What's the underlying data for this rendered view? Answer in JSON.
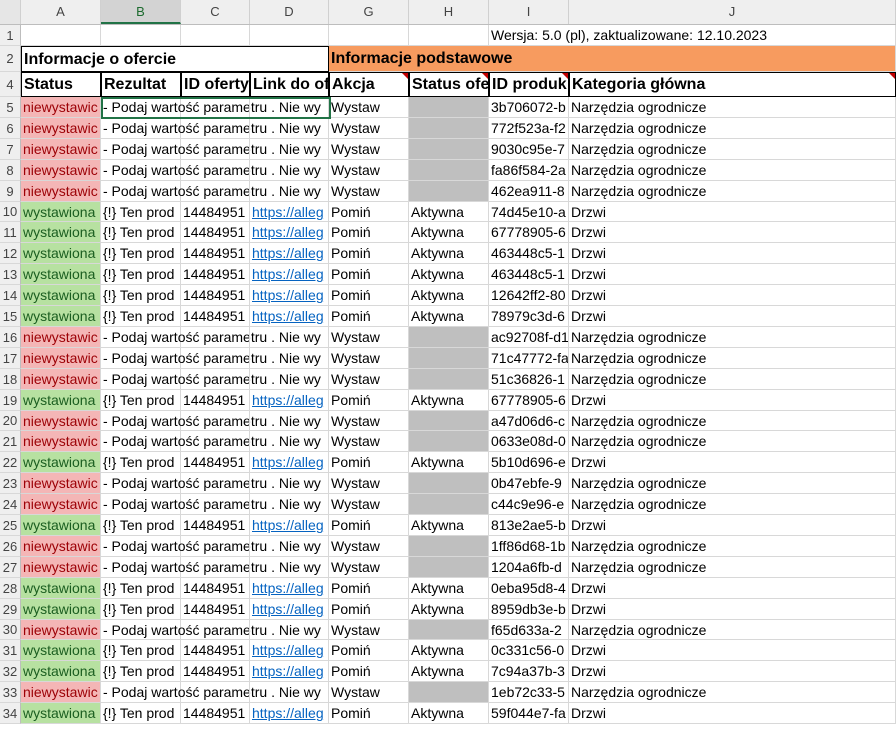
{
  "columns": [
    "A",
    "B",
    "C",
    "D",
    "G",
    "H",
    "I",
    "J"
  ],
  "row1": {
    "row": "1",
    "version": "Wersja: 5.0 (pl), zaktualizowane: 12.10.2023"
  },
  "row2": {
    "row": "2",
    "offer_info": "Informacje o ofercie",
    "basic_info": "Informacje podstawowe"
  },
  "row4": {
    "row": "4",
    "headers": [
      "Status",
      "Rezultat",
      "ID oferty",
      "Link do of",
      "Akcja",
      "Status ofe",
      "ID produk",
      "Kategoria główna"
    ]
  },
  "rows": [
    {
      "row": "5",
      "status": "niewystawic",
      "result": "- Podaj wartość parametru . Nie wy",
      "offer_id": "",
      "link": "",
      "action": "Wystaw",
      "offer_status": "",
      "product_id": "3b706072-b",
      "category": "Narzędzia ogrodnicze"
    },
    {
      "row": "6",
      "status": "niewystawic",
      "result": "- Podaj wartość parametru . Nie wy",
      "offer_id": "",
      "link": "",
      "action": "Wystaw",
      "offer_status": "",
      "product_id": "772f523a-f2",
      "category": "Narzędzia ogrodnicze"
    },
    {
      "row": "7",
      "status": "niewystawic",
      "result": "- Podaj wartość parametru . Nie wy",
      "offer_id": "",
      "link": "",
      "action": "Wystaw",
      "offer_status": "",
      "product_id": "9030c95e-7",
      "category": "Narzędzia ogrodnicze"
    },
    {
      "row": "8",
      "status": "niewystawic",
      "result": "- Podaj wartość parametru . Nie wy",
      "offer_id": "",
      "link": "",
      "action": "Wystaw",
      "offer_status": "",
      "product_id": "fa86f584-2a",
      "category": "Narzędzia ogrodnicze"
    },
    {
      "row": "9",
      "status": "niewystawic",
      "result": "- Podaj wartość parametru . Nie wy",
      "offer_id": "",
      "link": "",
      "action": "Wystaw",
      "offer_status": "",
      "product_id": "462ea911-8",
      "category": "Narzędzia ogrodnicze"
    },
    {
      "row": "10",
      "status": "wystawiona",
      "result": "{!} Ten prod",
      "offer_id": "14484951",
      "link": "https://alleg",
      "action": "Pomiń",
      "offer_status": "Aktywna",
      "product_id": "74d45e10-a",
      "category": "Drzwi"
    },
    {
      "row": "11",
      "status": "wystawiona",
      "result": "{!} Ten prod",
      "offer_id": "14484951",
      "link": "https://alleg",
      "action": "Pomiń",
      "offer_status": "Aktywna",
      "product_id": "67778905-6",
      "category": "Drzwi"
    },
    {
      "row": "12",
      "status": "wystawiona",
      "result": "{!} Ten prod",
      "offer_id": "14484951",
      "link": "https://alleg",
      "action": "Pomiń",
      "offer_status": "Aktywna",
      "product_id": "463448c5-1",
      "category": "Drzwi"
    },
    {
      "row": "13",
      "status": "wystawiona",
      "result": "{!} Ten prod",
      "offer_id": "14484951",
      "link": "https://alleg",
      "action": "Pomiń",
      "offer_status": "Aktywna",
      "product_id": "463448c5-1",
      "category": "Drzwi"
    },
    {
      "row": "14",
      "status": "wystawiona",
      "result": "{!} Ten prod",
      "offer_id": "14484951",
      "link": "https://alleg",
      "action": "Pomiń",
      "offer_status": "Aktywna",
      "product_id": "12642ff2-80",
      "category": "Drzwi"
    },
    {
      "row": "15",
      "status": "wystawiona",
      "result": "{!} Ten prod",
      "offer_id": "14484951",
      "link": "https://alleg",
      "action": "Pomiń",
      "offer_status": "Aktywna",
      "product_id": "78979c3d-6",
      "category": "Drzwi"
    },
    {
      "row": "16",
      "status": "niewystawic",
      "result": "- Podaj wartość parametru . Nie wy",
      "offer_id": "",
      "link": "",
      "action": "Wystaw",
      "offer_status": "",
      "product_id": "ac92708f-d1",
      "category": "Narzędzia ogrodnicze"
    },
    {
      "row": "17",
      "status": "niewystawic",
      "result": "- Podaj wartość parametru . Nie wy",
      "offer_id": "",
      "link": "",
      "action": "Wystaw",
      "offer_status": "",
      "product_id": "71c47772-fa",
      "category": "Narzędzia ogrodnicze"
    },
    {
      "row": "18",
      "status": "niewystawic",
      "result": "- Podaj wartość parametru . Nie wy",
      "offer_id": "",
      "link": "",
      "action": "Wystaw",
      "offer_status": "",
      "product_id": "51c36826-1",
      "category": "Narzędzia ogrodnicze"
    },
    {
      "row": "19",
      "status": "wystawiona",
      "result": "{!} Ten prod",
      "offer_id": "14484951",
      "link": "https://alleg",
      "action": "Pomiń",
      "offer_status": "Aktywna",
      "product_id": "67778905-6",
      "category": "Drzwi"
    },
    {
      "row": "20",
      "status": "niewystawic",
      "result": "- Podaj wartość parametru . Nie wy",
      "offer_id": "",
      "link": "",
      "action": "Wystaw",
      "offer_status": "",
      "product_id": "a47d06d6-c",
      "category": "Narzędzia ogrodnicze"
    },
    {
      "row": "21",
      "status": "niewystawic",
      "result": "- Podaj wartość parametru . Nie wy",
      "offer_id": "",
      "link": "",
      "action": "Wystaw",
      "offer_status": "",
      "product_id": "0633e08d-0",
      "category": "Narzędzia ogrodnicze"
    },
    {
      "row": "22",
      "status": "wystawiona",
      "result": "{!} Ten prod",
      "offer_id": "14484951",
      "link": "https://alleg",
      "action": "Pomiń",
      "offer_status": "Aktywna",
      "product_id": "5b10d696-e",
      "category": "Drzwi"
    },
    {
      "row": "23",
      "status": "niewystawic",
      "result": "- Podaj wartość parametru . Nie wy",
      "offer_id": "",
      "link": "",
      "action": "Wystaw",
      "offer_status": "",
      "product_id": "0b47ebfe-9",
      "category": "Narzędzia ogrodnicze"
    },
    {
      "row": "24",
      "status": "niewystawic",
      "result": "- Podaj wartość parametru . Nie wy",
      "offer_id": "",
      "link": "",
      "action": "Wystaw",
      "offer_status": "",
      "product_id": "c44c9e96-e",
      "category": "Narzędzia ogrodnicze"
    },
    {
      "row": "25",
      "status": "wystawiona",
      "result": "{!} Ten prod",
      "offer_id": "14484951",
      "link": "https://alleg",
      "action": "Pomiń",
      "offer_status": "Aktywna",
      "product_id": "813e2ae5-b",
      "category": "Drzwi"
    },
    {
      "row": "26",
      "status": "niewystawic",
      "result": "- Podaj wartość parametru . Nie wy",
      "offer_id": "",
      "link": "",
      "action": "Wystaw",
      "offer_status": "",
      "product_id": "1ff86d68-1b",
      "category": "Narzędzia ogrodnicze"
    },
    {
      "row": "27",
      "status": "niewystawic",
      "result": "- Podaj wartość parametru . Nie wy",
      "offer_id": "",
      "link": "",
      "action": "Wystaw",
      "offer_status": "",
      "product_id": "1204a6fb-d",
      "category": "Narzędzia ogrodnicze"
    },
    {
      "row": "28",
      "status": "wystawiona",
      "result": "{!} Ten prod",
      "offer_id": "14484951",
      "link": "https://alleg",
      "action": "Pomiń",
      "offer_status": "Aktywna",
      "product_id": "0eba95d8-4",
      "category": "Drzwi"
    },
    {
      "row": "29",
      "status": "wystawiona",
      "result": "{!} Ten prod",
      "offer_id": "14484951",
      "link": "https://alleg",
      "action": "Pomiń",
      "offer_status": "Aktywna",
      "product_id": "8959db3e-b",
      "category": "Drzwi"
    },
    {
      "row": "30",
      "status": "niewystawic",
      "result": "- Podaj wartość parametru . Nie wy",
      "offer_id": "",
      "link": "",
      "action": "Wystaw",
      "offer_status": "",
      "product_id": "f65d633a-2",
      "category": "Narzędzia ogrodnicze"
    },
    {
      "row": "31",
      "status": "wystawiona",
      "result": "{!} Ten prod",
      "offer_id": "14484951",
      "link": "https://alleg",
      "action": "Pomiń",
      "offer_status": "Aktywna",
      "product_id": "0c331c56-0",
      "category": "Drzwi"
    },
    {
      "row": "32",
      "status": "wystawiona",
      "result": "{!} Ten prod",
      "offer_id": "14484951",
      "link": "https://alleg",
      "action": "Pomiń",
      "offer_status": "Aktywna",
      "product_id": "7c94a37b-3",
      "category": "Drzwi"
    },
    {
      "row": "33",
      "status": "niewystawic",
      "result": "- Podaj wartość parametru . Nie wy",
      "offer_id": "",
      "link": "",
      "action": "Wystaw",
      "offer_status": "",
      "product_id": "1eb72c33-5",
      "category": "Narzędzia ogrodnicze"
    },
    {
      "row": "34",
      "status": "wystawiona",
      "result": "{!} Ten prod",
      "offer_id": "14484951",
      "link": "https://alleg",
      "action": "Pomiń",
      "offer_status": "Aktywna",
      "product_id": "59f044e7-fa",
      "category": "Drzwi"
    }
  ],
  "colors": {
    "red_fill": "#f4b6b6",
    "green_fill": "#b7e1a1",
    "grey_fill": "#bfbfbf",
    "orange_fill": "#f79b5f",
    "selection": "#217346"
  }
}
